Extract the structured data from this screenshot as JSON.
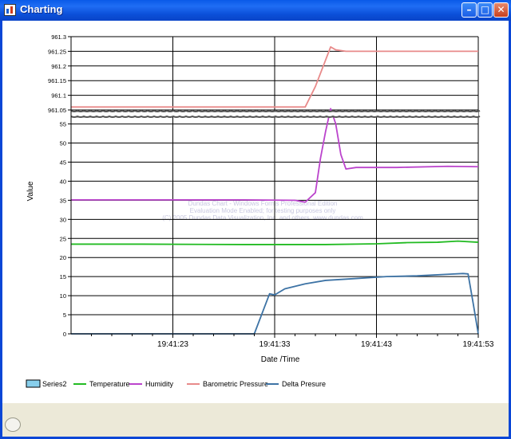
{
  "window": {
    "title": "Charting"
  },
  "icons": {
    "app": "chart-app-icon",
    "minimize": "minimize-icon",
    "maximize": "maximize-icon",
    "close": "close-icon"
  },
  "chart_data": {
    "type": "line",
    "xlabel": "Date /Time",
    "ylabel": "Value",
    "x_ticks": [
      "19:41:23",
      "19:41:33",
      "19:41:43",
      "19:41:53"
    ],
    "upper_y_ticks": [
      "961.3",
      "961.25",
      "961.2",
      "961.15",
      "961.1",
      "961.05"
    ],
    "upper_ylim": [
      961.05,
      961.3
    ],
    "lower_y_ticks": [
      "55",
      "50",
      "45",
      "40",
      "35",
      "30",
      "25",
      "20",
      "15",
      "10",
      "5",
      "0"
    ],
    "lower_ylim": [
      0,
      57
    ],
    "xlim": [
      13,
      53
    ],
    "grid": true,
    "legend_position": "bottom",
    "watermark": [
      "Dundas Chart - Windows Forms Professional Edition",
      "Evaluation Mode Enabled; for testing purposes only",
      "(C) 2005 Dundas Data Visualization, Inc. and others. www.dundas.com"
    ],
    "series": [
      {
        "name": "Series2",
        "color": "#87ceeb",
        "points": []
      },
      {
        "name": "Temperature",
        "color": "#22bb22",
        "points": [
          [
            13,
            23.5
          ],
          [
            20,
            23.5
          ],
          [
            30,
            23.4
          ],
          [
            38,
            23.4
          ],
          [
            43,
            23.6
          ],
          [
            46,
            23.9
          ],
          [
            49,
            24.0
          ],
          [
            51,
            24.3
          ],
          [
            53,
            24.0
          ]
        ]
      },
      {
        "name": "Humidity",
        "color": "#bb44cc",
        "points": [
          [
            13,
            35.1
          ],
          [
            30,
            35.1
          ],
          [
            35,
            35.0
          ],
          [
            36,
            34.5
          ],
          [
            37,
            37
          ],
          [
            37.5,
            46
          ],
          [
            38,
            53
          ],
          [
            38.5,
            59
          ],
          [
            39,
            55
          ],
          [
            39.5,
            47
          ],
          [
            40,
            43.2
          ],
          [
            41,
            43.6
          ],
          [
            45,
            43.6
          ],
          [
            50,
            43.9
          ],
          [
            53,
            43.8
          ]
        ]
      },
      {
        "name": "Barometric Pressure",
        "color": "#e88a8a",
        "points": [
          [
            13,
            961.06
          ],
          [
            36,
            961.06
          ],
          [
            37,
            961.13
          ],
          [
            38,
            961.22
          ],
          [
            38.5,
            961.265
          ],
          [
            39,
            961.255
          ],
          [
            40,
            961.25
          ],
          [
            53,
            961.25
          ]
        ]
      },
      {
        "name": "Delta Presure",
        "color": "#3d73a5",
        "points": [
          [
            13,
            0
          ],
          [
            31,
            0
          ],
          [
            32,
            7
          ],
          [
            32.5,
            10.5
          ],
          [
            33,
            10.2
          ],
          [
            34,
            11.8
          ],
          [
            36,
            13.1
          ],
          [
            38,
            14.0
          ],
          [
            41,
            14.5
          ],
          [
            44,
            15.0
          ],
          [
            47,
            15.2
          ],
          [
            50,
            15.6
          ],
          [
            51.5,
            15.8
          ],
          [
            52,
            15.7
          ],
          [
            52.5,
            8
          ],
          [
            53,
            0
          ]
        ]
      }
    ]
  }
}
